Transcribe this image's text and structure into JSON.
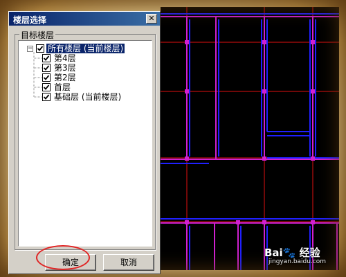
{
  "dialog": {
    "title": "楼层选择",
    "close_glyph": "✕",
    "group_label": "目标楼层",
    "tree": {
      "root": {
        "label": "所有楼层 (当前楼层)",
        "checked": true,
        "expander": "−"
      },
      "children": [
        {
          "label": "第4层",
          "checked": true
        },
        {
          "label": "第3层",
          "checked": true
        },
        {
          "label": "第2层",
          "checked": true
        },
        {
          "label": "首层",
          "checked": true
        },
        {
          "label": "基础层 (当前楼层)",
          "checked": true
        }
      ]
    },
    "ok_label": "确定",
    "cancel_label": "取消"
  },
  "watermark": {
    "brand": "Bai🐾 经验",
    "url": "jingyan.baidu.com"
  },
  "colors": {
    "titlebar": "#0a246a",
    "selection": "#0a246a",
    "highlight": "#e02424",
    "cad_wall": "#d020d0",
    "cad_blue": "#2020ff",
    "cad_grid": "#e01010"
  },
  "icons": {
    "close": "close-icon",
    "check": "check-icon",
    "expander": "collapse-icon"
  }
}
